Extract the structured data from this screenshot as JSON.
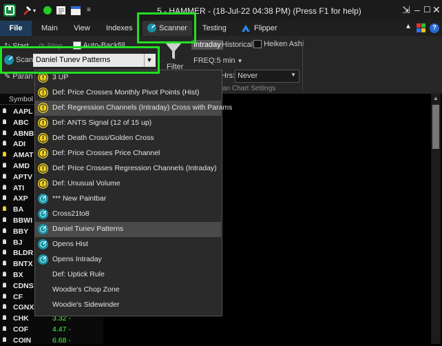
{
  "titlebar": {
    "title": "5 - HAMMER - (18-Jul-22 04:38 PM) (Press F1 for help)"
  },
  "tabs": [
    {
      "label": "File"
    },
    {
      "label": "Main"
    },
    {
      "label": "View"
    },
    {
      "label": "Indexes"
    },
    {
      "label": "Scanner"
    },
    {
      "label": "Testing"
    },
    {
      "label": "Flipper"
    }
  ],
  "ribbon": {
    "start_label": "Start",
    "stop_label": "Stop",
    "auto_backfill_label": "Auto-Backfill",
    "scan_label": "Scan",
    "scan_value": "Daniel Tunev Patterns",
    "params_label": "Paran",
    "filter_label": "Filter",
    "intraday_label": "Intraday",
    "historical_label": "Historical",
    "heiken_label": "Heiken Ashi",
    "freq_label": "FREQ:5 min",
    "hrs_label": "Hrs:",
    "hrs_value": "Never",
    "settings_caption": "can Chart Settings"
  },
  "grid": {
    "header": "Symbol",
    "rows": [
      {
        "symbol": "AAPL",
        "value": ""
      },
      {
        "symbol": "ABC",
        "value": ""
      },
      {
        "symbol": "ABNB",
        "value": ""
      },
      {
        "symbol": "ADI",
        "value": ""
      },
      {
        "symbol": "AMAT",
        "value": ""
      },
      {
        "symbol": "AMD",
        "value": ""
      },
      {
        "symbol": "APTV",
        "value": ""
      },
      {
        "symbol": "ATI",
        "value": ""
      },
      {
        "symbol": "AXP",
        "value": ""
      },
      {
        "symbol": "BA",
        "value": ""
      },
      {
        "symbol": "BBWI",
        "value": ""
      },
      {
        "symbol": "BBY",
        "value": ""
      },
      {
        "symbol": "BJ",
        "value": ""
      },
      {
        "symbol": "BLDR",
        "value": ""
      },
      {
        "symbol": "BNTX",
        "value": ""
      },
      {
        "symbol": "BX",
        "value": ""
      },
      {
        "symbol": "CDNS",
        "value": ""
      },
      {
        "symbol": "CF",
        "value": ""
      },
      {
        "symbol": "CGNX",
        "value": ""
      },
      {
        "symbol": "CHK",
        "value": "3.32 -"
      },
      {
        "symbol": "COF",
        "value": "4.47 -"
      },
      {
        "symbol": "COIN",
        "value": "6.68 -"
      }
    ]
  },
  "dropdown": {
    "items": [
      {
        "label": "3 UP",
        "icon": "yellow-info-icon"
      },
      {
        "label": "Def: Price Crosses Monthly Pivot Points (Hist)",
        "icon": "yellow-info-icon"
      },
      {
        "label": "Def: Regression Channels (Intraday) Cross with Params",
        "icon": "yellow-info-icon"
      },
      {
        "label": "Def: ANTS Signal (12 of 15 up)",
        "icon": "yellow-info-icon"
      },
      {
        "label": "Def: Death Cross/Golden Cross",
        "icon": "yellow-info-icon"
      },
      {
        "label": "Def: Price Crosses Price Channel",
        "icon": "yellow-info-icon"
      },
      {
        "label": "Def: Price Crosses Regression Channels (Intraday)",
        "icon": "yellow-info-icon"
      },
      {
        "label": "Def: Unusual Volume",
        "icon": "yellow-info-icon"
      },
      {
        "label": "*** New Paintbar",
        "icon": "teal-scan-icon"
      },
      {
        "label": "Cross21to8",
        "icon": "teal-scan-icon"
      },
      {
        "label": "Daniel Tunev Patterns",
        "icon": "teal-scan-icon"
      },
      {
        "label": "Opens Hist",
        "icon": "teal-scan-icon"
      },
      {
        "label": "Opens Intraday",
        "icon": "teal-scan-icon"
      },
      {
        "label": "Def: Uptick Rule",
        "icon": ""
      },
      {
        "label": "Woodie's Chop Zone",
        "icon": ""
      },
      {
        "label": "Woodie's Sidewinder",
        "icon": ""
      }
    ],
    "selected_index": 10
  },
  "colors": {
    "highlight": "#22e022",
    "file_tab": "#1e3c5a",
    "green_value": "#3cff3c"
  }
}
